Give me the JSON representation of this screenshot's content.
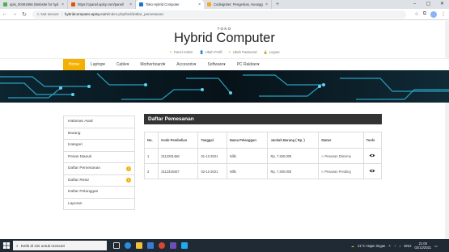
{
  "browser": {
    "tabs": [
      {
        "title": "apis_00491956 (Website for hyd",
        "color": "#4caf50",
        "active": false
      },
      {
        "title": "https://cpanel.apisy.com/panel/",
        "color": "#e65100",
        "active": false
      },
      {
        "title": "Toko Hybrid Computer",
        "color": "#1976d2",
        "active": true
      },
      {
        "title": "Codeigniter: Pengertian, Keungg",
        "color": "#f9a825",
        "active": false
      }
    ],
    "new_tab": "+",
    "security_label": "Not secure",
    "url_host": "hybridcomputer.apisy.com",
    "url_path": "/index.php/beli/daftar_pemesanan"
  },
  "site": {
    "store_label": "TOKO",
    "store_name": "Hybrid Computer",
    "user_links": [
      "Panel Admin",
      "Ubah Profil",
      "Ubah Password",
      "Logout"
    ],
    "menu": [
      "Home",
      "Laptop▾",
      "Cable▾",
      "Motherboard▾",
      "Accesoris▾",
      "Software▾",
      "PC Rakitan▾"
    ]
  },
  "sidebar": {
    "items": [
      {
        "label": "Halaman Awal",
        "badge": ""
      },
      {
        "label": "Barang",
        "badge": ""
      },
      {
        "label": "Kategori",
        "badge": ""
      },
      {
        "label": "Pesan Masuk",
        "badge": ""
      },
      {
        "label": "Daftar Pemesanan",
        "badge": "2"
      },
      {
        "label": "Daftar Retur",
        "badge": "0"
      },
      {
        "label": "Daftar Pelanggan",
        "badge": ""
      },
      {
        "label": "Laporan",
        "badge": ""
      }
    ]
  },
  "orders": {
    "title": "Daftar Pemesanan",
    "columns": [
      "No.",
      "Kode Pembelian",
      "Tanggal",
      "Nama Pelanggan",
      "Jumlah Barang ( Rp. )",
      "Status",
      "Tools"
    ],
    "rows": [
      [
        "1",
        "3112281458",
        "01-12-2021",
        "Nifki",
        "Rp. 7.260.000",
        "Pesanan Diterima"
      ],
      [
        "2",
        "3112325457",
        "02-12-2021",
        "Nifki",
        "Rp. 7.300.000",
        "Pesanan Pending"
      ]
    ]
  },
  "taskbar": {
    "search_placeholder": "Ketik di sini untuk mencari",
    "weather": "21°C  Hujan ringan",
    "lang": "ENG",
    "time": "21:00",
    "date": "02/12/2021"
  }
}
